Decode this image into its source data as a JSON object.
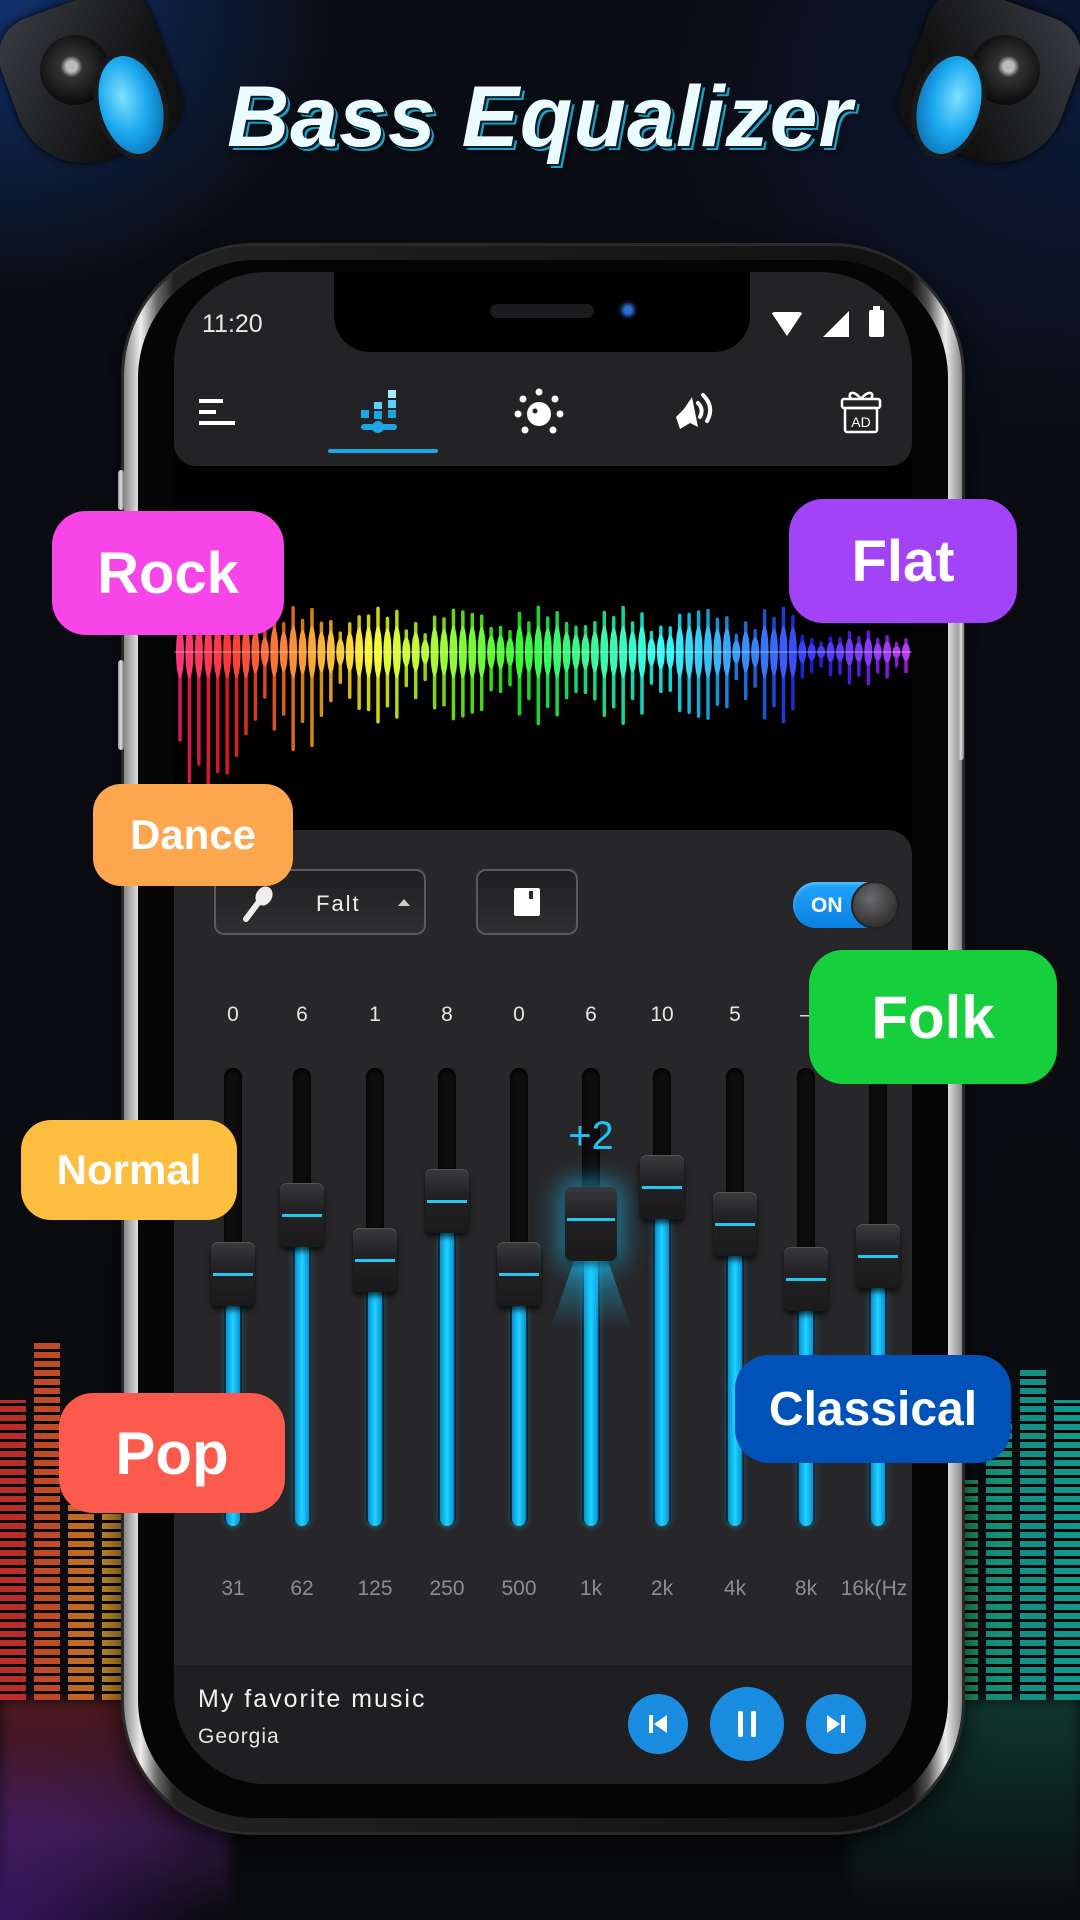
{
  "banner": {
    "title": "Bass Equalizer"
  },
  "status_bar": {
    "time": "11:20",
    "icons": [
      "wifi-icon",
      "signal-icon",
      "battery-icon"
    ]
  },
  "toolbar": {
    "items": [
      {
        "icon": "menu-icon",
        "active": false
      },
      {
        "icon": "equalizer-icon",
        "active": true
      },
      {
        "icon": "bass-boost-knob-icon",
        "active": false
      },
      {
        "icon": "volume-icon",
        "active": false
      },
      {
        "icon": "gift-ad-icon",
        "label": "AD",
        "active": false
      }
    ],
    "accent_color": "#19a7e4"
  },
  "controls": {
    "preset_name": "Falt",
    "preset_icon": "microphone-icon",
    "save_icon": "save-icon",
    "toggle_label": "ON",
    "toggle_on": true
  },
  "equalizer": {
    "unit_label": "(Hz",
    "bands": [
      {
        "freq": "31",
        "value": "0",
        "level": 0.55
      },
      {
        "freq": "62",
        "value": "6",
        "level": 0.68
      },
      {
        "freq": "125",
        "value": "1",
        "level": 0.58
      },
      {
        "freq": "250",
        "value": "8",
        "level": 0.71
      },
      {
        "freq": "500",
        "value": "0",
        "level": 0.55
      },
      {
        "freq": "1k",
        "value": "6",
        "level": 0.66
      },
      {
        "freq": "2k",
        "value": "10",
        "level": 0.74
      },
      {
        "freq": "4k",
        "value": "5",
        "level": 0.66
      },
      {
        "freq": "8k",
        "value": "–",
        "level": 0.54
      },
      {
        "freq": "16k(Hz",
        "value": "",
        "level": 0.59
      }
    ],
    "active_band": 5,
    "active_tooltip": "+2"
  },
  "player": {
    "title": "My favorite music",
    "artist": "Georgia",
    "buttons": [
      "previous",
      "pause",
      "next"
    ]
  },
  "preset_tags": [
    {
      "label": "Rock",
      "color": "#f745e8"
    },
    {
      "label": "Flat",
      "color": "#a243f7"
    },
    {
      "label": "Dance",
      "color": "#fca64e"
    },
    {
      "label": "Folk",
      "color": "#15cf3c"
    },
    {
      "label": "Normal",
      "color": "#fdbd3e"
    },
    {
      "label": "Pop",
      "color": "#fb5a4d"
    },
    {
      "label": "Classical",
      "color": "#0052b8"
    }
  ]
}
